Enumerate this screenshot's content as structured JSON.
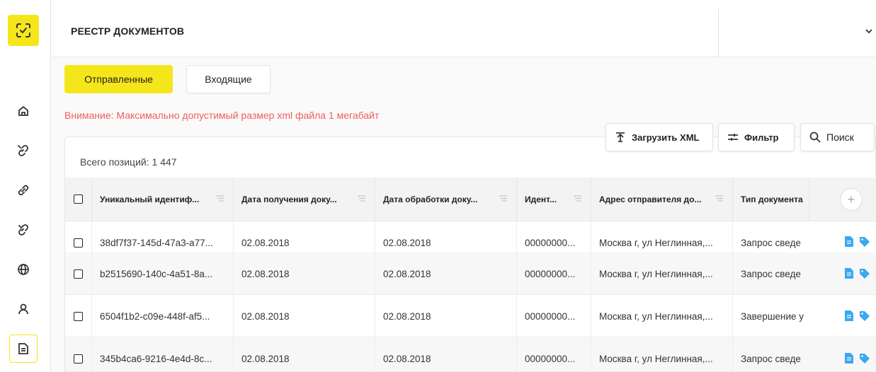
{
  "app": {
    "title": "РЕЕСТР ДОКУМЕНТОВ",
    "accent": "#f5e61b",
    "warning_color": "#f05d5d"
  },
  "sidebar": {
    "logo_icon": "scan-check-icon",
    "items": [
      {
        "icon": "home-icon"
      },
      {
        "icon": "broken-link-icon"
      },
      {
        "icon": "link-icon"
      },
      {
        "icon": "unlink-icon"
      },
      {
        "icon": "globe-icon"
      },
      {
        "icon": "user-icon"
      },
      {
        "icon": "document-icon",
        "active": true
      }
    ]
  },
  "tabs": {
    "sent": "Отправленные",
    "inbox": "Входящие"
  },
  "warning": "Внимание: Максимально допустимый размер xml файла 1 мегабайт",
  "toolbar": {
    "upload": "Загрузить XML",
    "filter": "Фильтр",
    "search": "Поиск"
  },
  "table": {
    "total": "Всего позиций: 1 447",
    "columns": [
      "Уникальный идентиф...",
      "Дата получения доку...",
      "Дата обработки доку...",
      "Идент...",
      "Адрес отправителя до...",
      "Тип документа"
    ],
    "add_column": "+",
    "rows": [
      [
        "38df7f37-145d-47a3-a77...",
        "02.08.2018",
        "02.08.2018",
        "00000000...",
        "Москва г, ул Неглинная,...",
        "Запрос сведе"
      ],
      [
        "b2515690-140c-4a51-8a...",
        "02.08.2018",
        "02.08.2018",
        "00000000...",
        "Москва г, ул Неглинная,...",
        "Запрос сведе"
      ],
      [
        "6504f1b2-c09e-448f-af5...",
        "02.08.2018",
        "02.08.2018",
        "00000000...",
        "Москва г, ул Неглинная,...",
        "Завершение у"
      ],
      [
        "345b4ca6-9216-4e4d-8c...",
        "02.08.2018",
        "02.08.2018",
        "00000000...",
        "Москва г, ул Неглинная,...",
        "Запрос сведе"
      ]
    ]
  }
}
